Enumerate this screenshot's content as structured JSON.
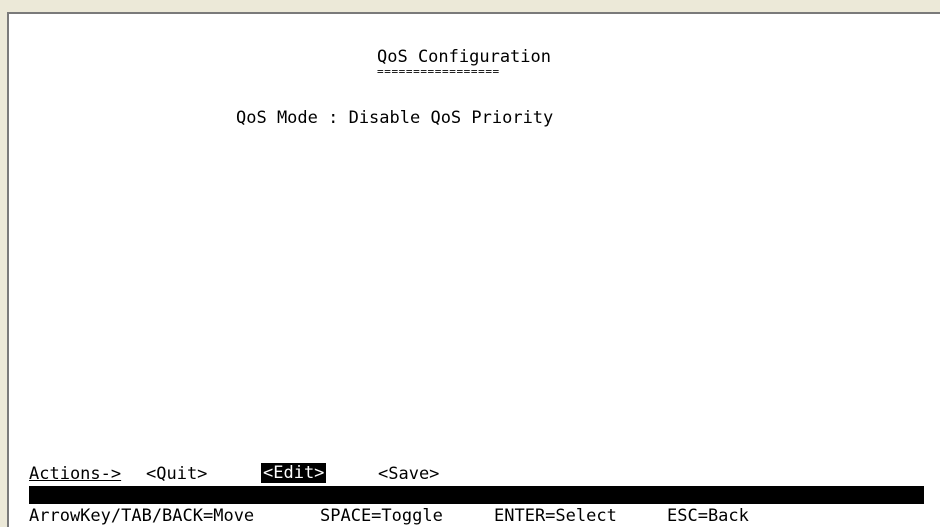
{
  "screen": {
    "title": "QoS Configuration",
    "title_rule": "=================",
    "qos_mode_line": "QoS Mode : Disable QoS Priority"
  },
  "actions": {
    "label": "Actions->",
    "quit": "<Quit>",
    "edit": "<Edit>",
    "save": "<Save>",
    "selected": "edit"
  },
  "help": {
    "move": "ArrowKey/TAB/BACK=Move",
    "toggle": "SPACE=Toggle",
    "select": "ENTER=Select",
    "back": "ESC=Back"
  },
  "colors": {
    "background": "#ffffff",
    "text": "#000000",
    "highlight_bg": "#000000",
    "highlight_text": "#ffffff",
    "window_frame": "#ece9d8"
  }
}
